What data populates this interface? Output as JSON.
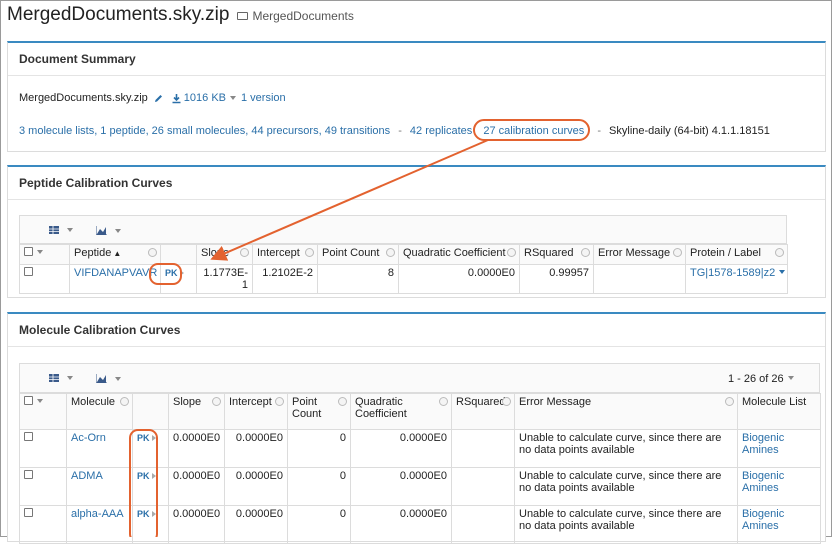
{
  "header": {
    "title": "MergedDocuments.sky.zip",
    "folder": "MergedDocuments"
  },
  "summary": {
    "title": "Document Summary",
    "filename": "MergedDocuments.sky.zip",
    "size": "1016 KB",
    "versions": "1 version",
    "stats_link": "3 molecule lists, 1 peptide, 26 small molecules, 44 precursors, 49 transitions",
    "sep1": "-",
    "replicates": "42 replicates",
    "calib_curves": "27 calibration curves",
    "sep2": "-",
    "software": "Skyline-daily (64-bit) 4.1.1.18151"
  },
  "peptide_panel": {
    "title": "Peptide Calibration Curves",
    "columns": [
      "Peptide",
      "Slope",
      "Intercept",
      "Point Count",
      "Quadratic Coefficient",
      "RSquared",
      "Error Message",
      "Protein / Label"
    ],
    "row": {
      "peptide": "VIFDANAPVAVR",
      "pk": "PK",
      "slope": "1.1773E-1",
      "intercept": "1.2102E-2",
      "point_count": "8",
      "quadratic": "0.0000E0",
      "rsquared": "0.99957",
      "error": "",
      "protein": "TG|1578-1589|z2"
    }
  },
  "molecule_panel": {
    "title": "Molecule Calibration Curves",
    "paging": "1 - 26 of 26",
    "columns": {
      "molecule": "Molecule",
      "slope": "Slope",
      "intercept": "Intercept",
      "point_count_1": "Point",
      "point_count_2": "Count",
      "quadratic_1": "Quadratic",
      "quadratic_2": "Coefficient",
      "rsquared": "RSquared",
      "error": "Error Message",
      "list": "Molecule List"
    },
    "rows": [
      {
        "molecule": "Ac-Orn",
        "pk": "PK",
        "slope": "0.0000E0",
        "intercept": "0.0000E0",
        "count": "0",
        "quadratic": "0.0000E0",
        "rsquared": "",
        "error_1": "Unable to calculate curve, since there are",
        "error_2": "no data points available",
        "list_1": "Biogenic",
        "list_2": "Amines"
      },
      {
        "molecule": "ADMA",
        "pk": "PK",
        "slope": "0.0000E0",
        "intercept": "0.0000E0",
        "count": "0",
        "quadratic": "0.0000E0",
        "rsquared": "",
        "error_1": "Unable to calculate curve, since there are",
        "error_2": "no data points available",
        "list_1": "Biogenic",
        "list_2": "Amines"
      },
      {
        "molecule": "alpha-AAA",
        "pk": "PK",
        "slope": "0.0000E0",
        "intercept": "0.0000E0",
        "count": "0",
        "quadratic": "0.0000E0",
        "rsquared": "",
        "error_1": "Unable to calculate curve, since there are",
        "error_2": "no data points available",
        "list_1": "Biogenic",
        "list_2": "Amines"
      }
    ]
  },
  "colors": {
    "link": "#2a6fa8",
    "accent": "#3a8ac1",
    "callout": "#e3622f"
  }
}
